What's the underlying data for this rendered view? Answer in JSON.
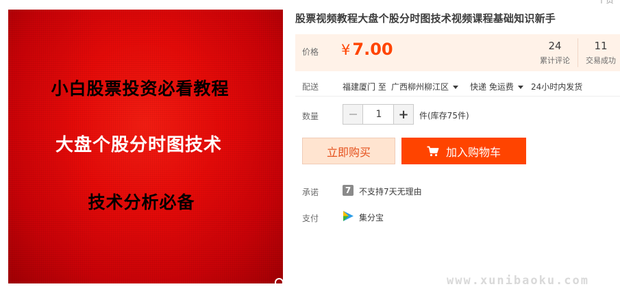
{
  "top_fragment": "个赞",
  "image": {
    "line1": "小白股票投资必看教程",
    "line2": "大盘个股分时图技术",
    "line3": "技术分析必备"
  },
  "title": "股票视频教程大盘个股分时图技术视频课程基础知识新手",
  "price": {
    "label": "价格",
    "currency": "¥",
    "amount": "7.00",
    "color": "#ff4400"
  },
  "stats": {
    "reviews_count": "24",
    "reviews_label": "累计评论",
    "deals_count": "11",
    "deals_label": "交易成功"
  },
  "shipping": {
    "label": "配送",
    "from": "福建厦门 至",
    "to": "广西柳州柳江区",
    "method": "快递 免运费",
    "dispatch": "24小时内发货"
  },
  "quantity": {
    "label": "数量",
    "value": "1",
    "stock": "件(库存75件)"
  },
  "buttons": {
    "buy_now": "立即购买",
    "add_to_cart": "加入购物车"
  },
  "promise": {
    "label": "承诺",
    "badge": "7",
    "text": "不支持7天无理由"
  },
  "payment": {
    "label": "支付",
    "method": "集分宝"
  },
  "watermark": "www.xunibaoku.com",
  "icons": {
    "zoom": "search-icon",
    "cart": "cart-icon",
    "payment": "jifenbao-icon"
  }
}
